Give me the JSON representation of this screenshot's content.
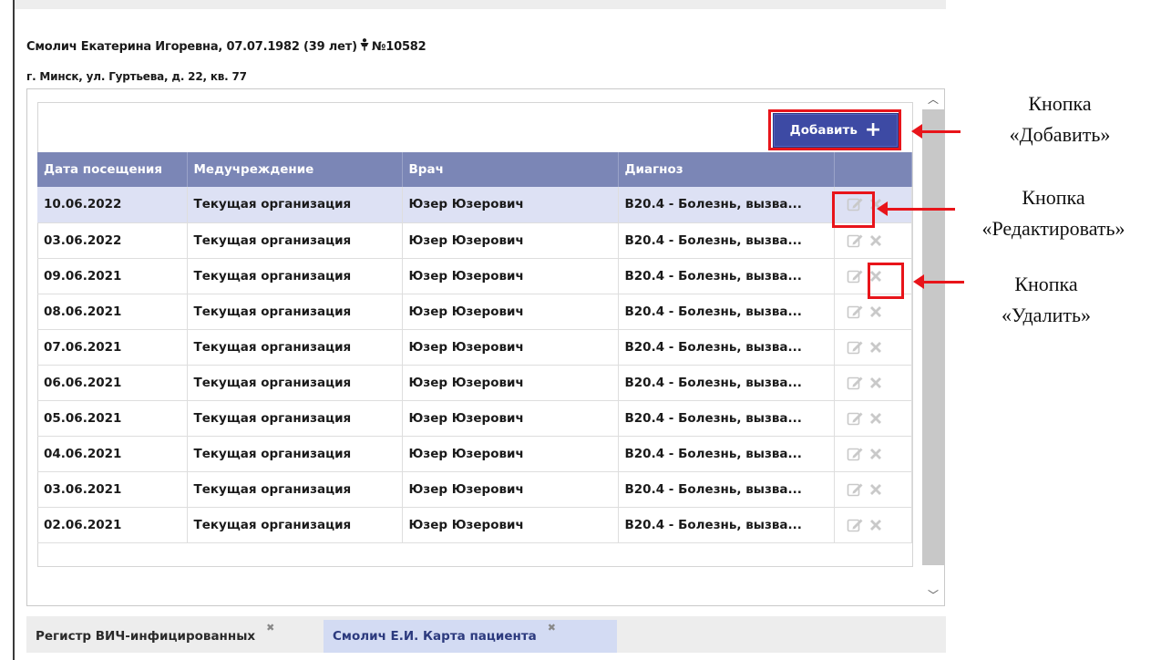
{
  "patient": {
    "name_line_start": "Смолич Екатерина Игоревна, 07.07.1982 (39 лет)",
    "gender_icon": "female-person-icon",
    "card_number": "№10582",
    "address": "г. Минск, ул. Гуртьева, д. 22, кв. 77"
  },
  "toolbar": {
    "add_label": "Добавить",
    "add_icon": "plus-icon"
  },
  "table": {
    "columns": [
      "Дата посещения",
      "Медучреждение",
      "Врач",
      "Диагноз",
      ""
    ],
    "rows": [
      {
        "date": "10.06.2022",
        "org": "Текущая организация",
        "doctor": "Юзер Юзерович",
        "diagnosis": "B20.4 - Болезнь, вызва..."
      },
      {
        "date": "03.06.2022",
        "org": "Текущая организация",
        "doctor": "Юзер Юзерович",
        "diagnosis": "B20.4 - Болезнь, вызва..."
      },
      {
        "date": "09.06.2021",
        "org": "Текущая организация",
        "doctor": "Юзер Юзерович",
        "diagnosis": "B20.4 - Болезнь, вызва..."
      },
      {
        "date": "08.06.2021",
        "org": "Текущая организация",
        "doctor": "Юзер Юзерович",
        "diagnosis": "B20.4 - Болезнь, вызва..."
      },
      {
        "date": "07.06.2021",
        "org": "Текущая организация",
        "doctor": "Юзер Юзерович",
        "diagnosis": "B20.4 - Болезнь, вызва..."
      },
      {
        "date": "06.06.2021",
        "org": "Текущая организация",
        "doctor": "Юзер Юзерович",
        "diagnosis": "B20.4 - Болезнь, вызва..."
      },
      {
        "date": "05.06.2021",
        "org": "Текущая организация",
        "doctor": "Юзер Юзерович",
        "diagnosis": "B20.4 - Болезнь, вызва..."
      },
      {
        "date": "04.06.2021",
        "org": "Текущая организация",
        "doctor": "Юзер Юзерович",
        "diagnosis": "B20.4 - Болезнь, вызва..."
      },
      {
        "date": "03.06.2021",
        "org": "Текущая организация",
        "doctor": "Юзер Юзерович",
        "diagnosis": "B20.4 - Болезнь, вызва..."
      },
      {
        "date": "02.06.2021",
        "org": "Текущая организация",
        "doctor": "Юзер Юзерович",
        "diagnosis": "B20.4 - Болезнь, вызва..."
      }
    ]
  },
  "annotations": {
    "add": "Кнопка\n«Добавить»",
    "edit": "Кнопка\n«Редактировать»",
    "delete": "Кнопка\n«Удалить»"
  },
  "tabs": [
    {
      "label": "Регистр ВИЧ-инфицированных",
      "close": "✖"
    },
    {
      "label": "Смолич Е.И. Карта пациента",
      "close": "✖"
    }
  ],
  "colors": {
    "header_bg": "#7b86b6",
    "button_bg": "#3d4aa4",
    "selected_row": "#dde1f4",
    "annotation_red": "#e8141a"
  }
}
